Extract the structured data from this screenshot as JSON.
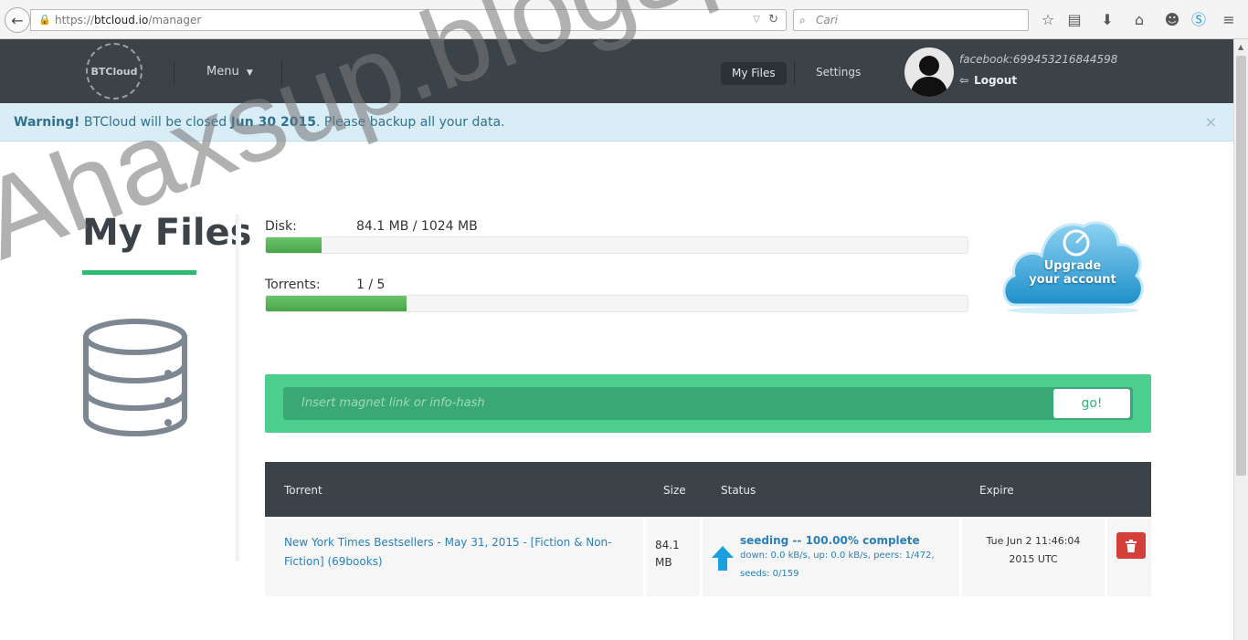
{
  "browser": {
    "url_prefix": "https://",
    "url_host": "btcloud.io",
    "url_path": "/manager",
    "search_placeholder": "Cari"
  },
  "header": {
    "logo_text": "BTCloud",
    "menu_label": "Menu",
    "nav_myfiles": "My Files",
    "nav_settings": "Settings",
    "user_id": "facebook:699453216844598",
    "logout_label": "Logout"
  },
  "warning": {
    "strong": "Warning!",
    "text_before": "BTCloud will be closed",
    "date": "Jun 30 2015",
    "text_after": ". Please backup all your data.",
    "close": "×"
  },
  "page": {
    "title": "My Files"
  },
  "usage": {
    "disk_label": "Disk:",
    "disk_value": "84.1 MB / 1024 MB",
    "disk_fraction": 0.08,
    "torrents_label": "Torrents:",
    "torrents_value": "1 / 5",
    "torrents_fraction": 0.2
  },
  "upgrade": {
    "line1": "Upgrade",
    "line2": "your account"
  },
  "magnet": {
    "placeholder": "Insert magnet link or info-hash",
    "go_label": "go!"
  },
  "table": {
    "headers": [
      "Torrent",
      "Size",
      "Status",
      "Expire"
    ],
    "rows": [
      {
        "name": "New York Times Bestsellers - May 31, 2015 - [Fiction & Non-Fiction] (69books)",
        "size": "84.1 MB",
        "status": "seeding -- 100.00% complete",
        "status_detail": "down: 0.0 kB/s, up: 0.0 kB/s, peers: 1/472, seeds: 0/159",
        "expire_line1": "Tue Jun 2 11:46:04",
        "expire_line2": "2015 UTC"
      }
    ]
  },
  "watermark": "Ahaxsup.blogspot.com",
  "colors": {
    "header_bg": "#3b4349",
    "accent_green": "#2eb872",
    "magnet_bg": "#4cce8e",
    "link_blue": "#2980b9",
    "delete_red": "#d43f3a",
    "warning_bg": "#d9edf7"
  }
}
